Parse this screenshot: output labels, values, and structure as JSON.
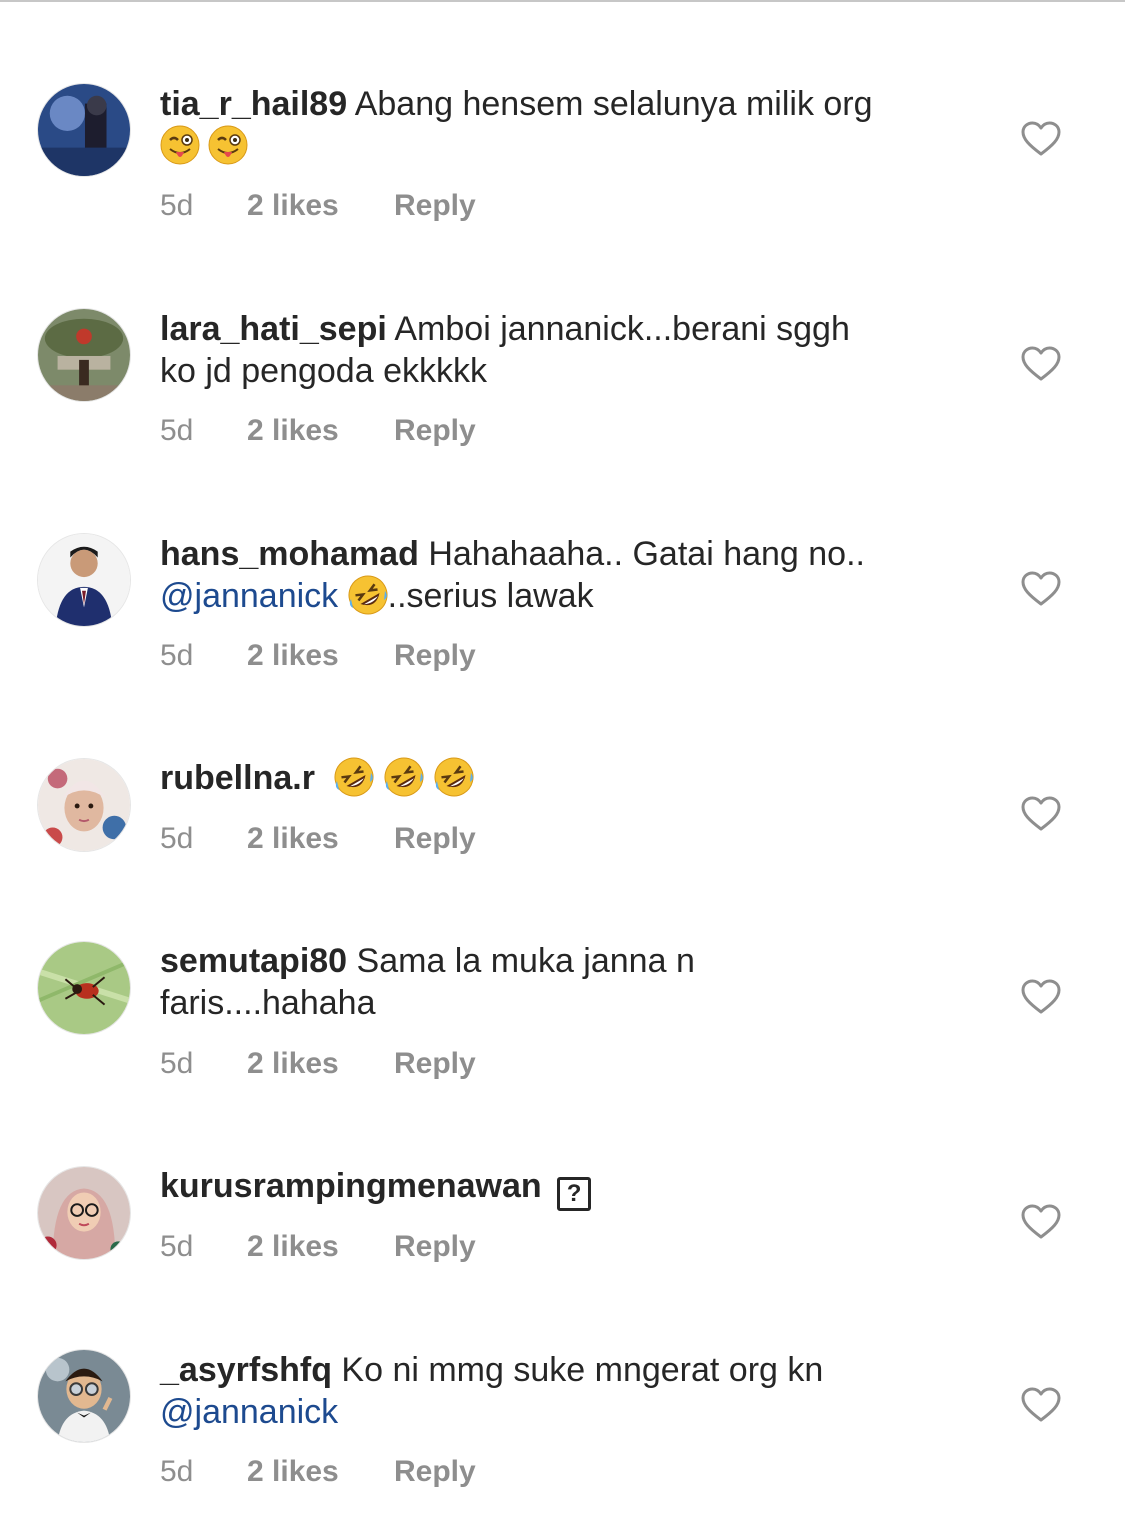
{
  "comments": [
    {
      "username": "tia_r_hail89",
      "text": "Abang hensem selalunya milik org",
      "emojis": [
        "winking-face-with-tongue",
        "winking-face-with-tongue"
      ],
      "time": "5d",
      "likes": "2 likes",
      "reply": "Reply"
    },
    {
      "username": "lara_hati_sepi",
      "text": "Amboi jannanick...berani sggh",
      "text2": "ko jd pengoda ekkkkk",
      "time": "5d",
      "likes": "2 likes",
      "reply": "Reply"
    },
    {
      "username": "hans_mohamad",
      "text": "Hahahaaha.. Gatai hang no..",
      "mention": "@jannanick",
      "emoji": "rolling-on-floor-laughing",
      "text2": "..serius lawak",
      "time": "5d",
      "likes": "2 likes",
      "reply": "Reply"
    },
    {
      "username": "rubellna.r",
      "emojis": [
        "rolling-on-floor-laughing",
        "rolling-on-floor-laughing",
        "rolling-on-floor-laughing"
      ],
      "time": "5d",
      "likes": "2 likes",
      "reply": "Reply"
    },
    {
      "username": "semutapi80",
      "text": "Sama la muka janna n",
      "text2": "faris....hahaha",
      "time": "5d",
      "likes": "2 likes",
      "reply": "Reply"
    },
    {
      "username": "kurusrampingmenawan",
      "unknown_glyph": "?",
      "time": "5d",
      "likes": "2 likes",
      "reply": "Reply"
    },
    {
      "username": "_asyrfshfq",
      "text": "Ko ni mmg suke mngerat org kn",
      "mention": "@jannanick",
      "time": "5d",
      "likes": "2 likes",
      "reply": "Reply"
    }
  ],
  "colors": {
    "text": "#262626",
    "meta": "#8e8e8e",
    "mention": "#1d4a8f",
    "heart_outline": "#8e8e8e"
  },
  "icons": {
    "like": "heart-outline-icon"
  }
}
